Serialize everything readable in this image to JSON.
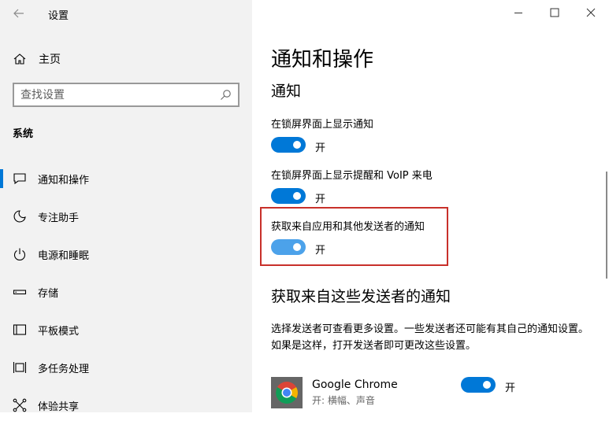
{
  "window": {
    "title": "设置",
    "controls": [
      "minimize-icon",
      "maximize-icon",
      "close-icon"
    ]
  },
  "sidebar": {
    "home_label": "主页",
    "search_placeholder": "查找设置",
    "section_label": "系统",
    "items": [
      {
        "label": "通知和操作",
        "icon": "message-icon",
        "selected": true
      },
      {
        "label": "专注助手",
        "icon": "moon-icon",
        "selected": false
      },
      {
        "label": "电源和睡眠",
        "icon": "power-icon",
        "selected": false
      },
      {
        "label": "存储",
        "icon": "storage-icon",
        "selected": false
      },
      {
        "label": "平板模式",
        "icon": "tablet-icon",
        "selected": false
      },
      {
        "label": "多任务处理",
        "icon": "multitask-icon",
        "selected": false
      },
      {
        "label": "体验共享",
        "icon": "share-icon",
        "selected": false
      }
    ]
  },
  "main": {
    "page_title": "通知和操作",
    "notifications_heading": "通知",
    "settings": [
      {
        "label": "在锁屏界面上显示通知",
        "state": "开",
        "on": true
      },
      {
        "label": "在锁屏界面上显示提醒和 VoIP 来电",
        "state": "开",
        "on": true
      },
      {
        "label": "获取来自应用和其他发送者的通知",
        "state": "开",
        "on": true,
        "highlighted": true
      }
    ],
    "senders_heading": "获取来自这些发送者的通知",
    "senders_description": "选择发送者可查看更多设置。一些发送者还可能有其自己的通知设置。如果是这样，打开发送者即可更改这些设置。",
    "senders": [
      {
        "name": "Google Chrome",
        "detail": "开: 横幅、声音",
        "state": "开",
        "on": true,
        "icon": "chrome-icon"
      }
    ]
  },
  "colors": {
    "accent": "#0078d7",
    "accent_light": "#4ca2ea",
    "highlight_border": "#c8302a",
    "sidebar_bg": "#f2f2f2"
  }
}
